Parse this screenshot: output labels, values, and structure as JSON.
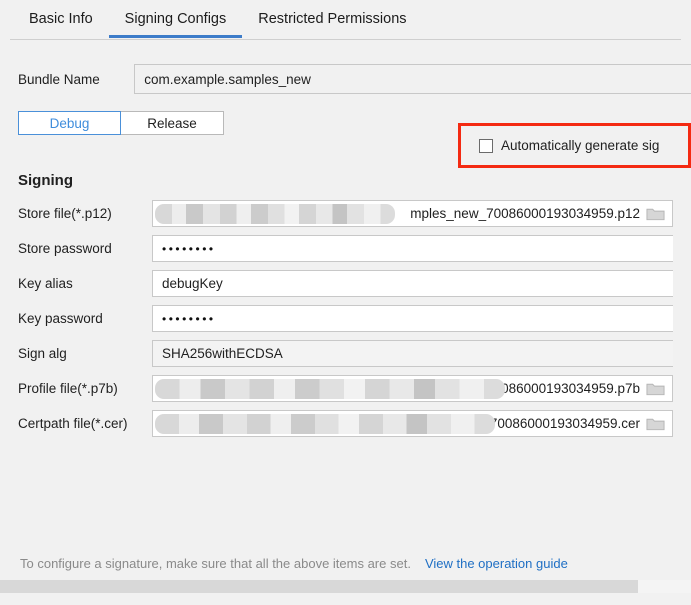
{
  "tabs": [
    {
      "label": "Basic Info",
      "active": false
    },
    {
      "label": "Signing Configs",
      "active": true
    },
    {
      "label": "Restricted Permissions",
      "active": false
    }
  ],
  "bundle": {
    "label": "Bundle Name",
    "value": "com.example.samples_new"
  },
  "build_variant": {
    "debug_label": "Debug",
    "release_label": "Release",
    "selected": "Debug"
  },
  "auto_generate": {
    "label": "Automatically generate sig",
    "checked": false,
    "highlight_color": "#f42a12"
  },
  "signing": {
    "title": "Signing",
    "fields": [
      {
        "label": "Store file(*.p12)",
        "value": "mples_new_70086000193034959.p12",
        "type": "file",
        "redacted": true,
        "redact_width": 240
      },
      {
        "label": "Store password",
        "value": "••••••••",
        "type": "password",
        "redacted": false
      },
      {
        "label": "Key alias",
        "value": "debugKey",
        "type": "text",
        "redacted": false
      },
      {
        "label": "Key password",
        "value": "••••••••",
        "type": "password",
        "redacted": false
      },
      {
        "label": "Sign alg",
        "value": "SHA256withECDSA",
        "type": "text",
        "redacted": false
      },
      {
        "label": "Profile file(*.p7b)",
        "value": "_debug_samples_new_70086000193034959.p7b",
        "type": "file",
        "redacted": true,
        "redact_width": 350
      },
      {
        "label": "Certpath file(*.cer)",
        "value": "g_samples_new_70086000193034959.cer",
        "type": "file",
        "redacted": true,
        "redact_width": 340
      }
    ],
    "browse_icon": "folder-icon"
  },
  "footer": {
    "hint": "To configure a signature, make sure that all the above items are set.",
    "link": "View the operation guide"
  },
  "colors": {
    "accent": "#3d7cc9",
    "link": "#1f6fc4",
    "selected_segment": "#3f8ddc",
    "page_bg": "#f1f1f1"
  }
}
